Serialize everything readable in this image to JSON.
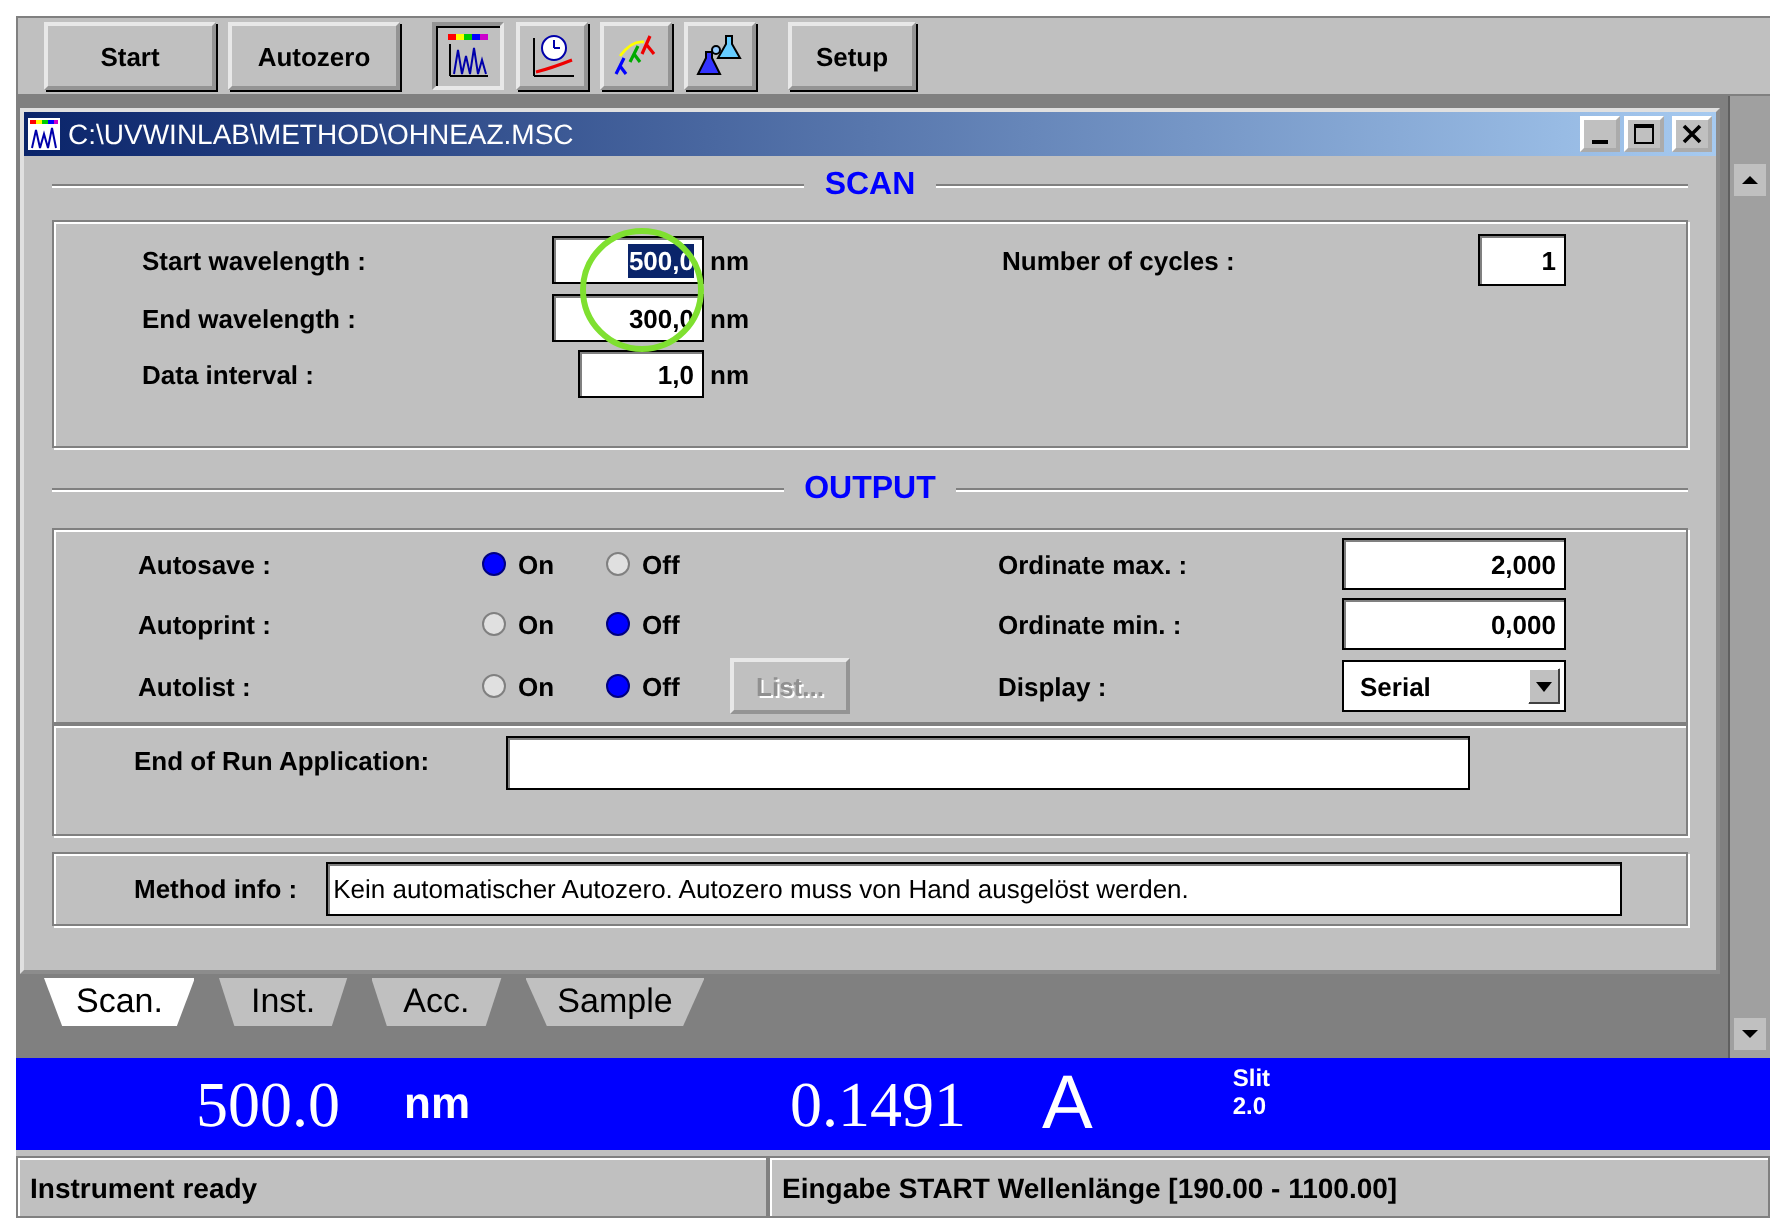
{
  "toolbar": {
    "buttons": [
      {
        "kind": "text",
        "label": "Start",
        "selected": false
      },
      {
        "kind": "text",
        "label": "Autozero",
        "selected": false
      },
      {
        "kind": "icon",
        "selected": true
      },
      {
        "kind": "icon",
        "selected": false
      },
      {
        "kind": "icon",
        "selected": false
      },
      {
        "kind": "icon",
        "selected": false
      },
      {
        "kind": "text",
        "label": "Setup",
        "selected": false
      }
    ]
  },
  "window": {
    "title": "C:\\UVWINLAB\\METHOD\\OHNEAZ.MSC"
  },
  "scan": {
    "title": "SCAN",
    "fields": [
      {
        "label": "Start wavelength :",
        "value": "500,0",
        "unit": "nm",
        "selected": true
      },
      {
        "label": "End wavelength :",
        "value": "300,0",
        "unit": "nm",
        "selected": false
      },
      {
        "label": "Data interval :",
        "value": "1,0",
        "unit": "nm",
        "selected": false
      }
    ],
    "cycles": {
      "label": "Number of cycles :",
      "value": "1"
    }
  },
  "output": {
    "title": "OUTPUT",
    "switches": [
      {
        "label": "Autosave :",
        "options": [
          {
            "label": "On",
            "selected": true
          },
          {
            "label": "Off",
            "selected": false
          }
        ]
      },
      {
        "label": "Autoprint :",
        "options": [
          {
            "label": "On",
            "selected": false
          },
          {
            "label": "Off",
            "selected": true
          }
        ]
      },
      {
        "label": "Autolist :",
        "options": [
          {
            "label": "On",
            "selected": false
          },
          {
            "label": "Off",
            "selected": true
          }
        ],
        "button": {
          "label": "List...",
          "disabled": true
        }
      }
    ],
    "settings": [
      {
        "kind": "field",
        "label": "Ordinate max. :",
        "value": "2,000"
      },
      {
        "kind": "field",
        "label": "Ordinate min. :",
        "value": "0,000"
      },
      {
        "kind": "dropdown",
        "label": "Display :",
        "value": "Serial"
      }
    ],
    "end_of_run": {
      "label": "End of Run Application:"
    },
    "method_info": {
      "label": "Method info :",
      "value": "Kein automatischer Autozero. Autozero muss von Hand ausgelöst werden."
    }
  },
  "tabs": [
    {
      "label": "Scan.",
      "selected": true
    },
    {
      "label": "Inst.",
      "selected": false
    },
    {
      "label": "Acc.",
      "selected": false
    },
    {
      "label": "Sample",
      "selected": false
    }
  ],
  "readout": {
    "wavelength": "500.0",
    "wavelength_unit": "nm",
    "absorbance": "0.1491",
    "absorbance_unit": "A",
    "slit_label": "Slit",
    "slit_value": "2.0"
  },
  "status_bar": [
    "Instrument ready",
    "Eingabe START Wellenlänge [190.00 - 1100.00]"
  ]
}
